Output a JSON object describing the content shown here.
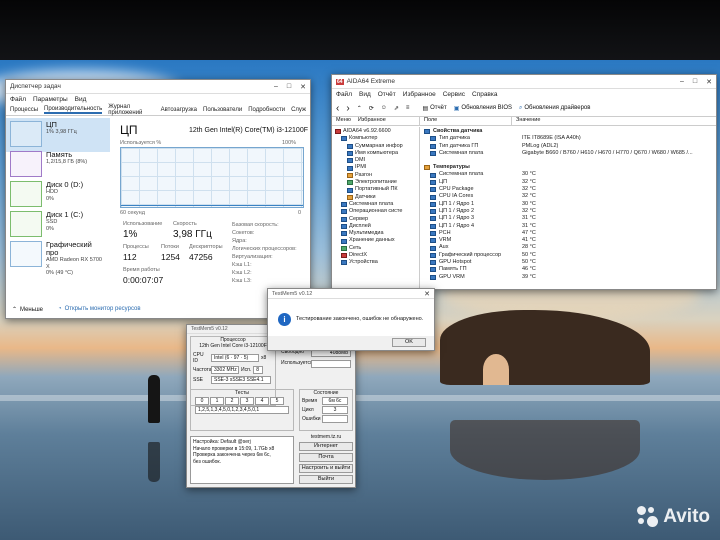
{
  "colors": {
    "accent": "#2b6cb0",
    "cpu_graph": "#76a6cf",
    "error_red": "#c93b3b"
  },
  "taskmgr": {
    "title": "Диспетчер задач",
    "menu": [
      "Файл",
      "Параметры",
      "Вид"
    ],
    "tabs": [
      "Процессы",
      "Производительность",
      "Журнал приложений",
      "Автозагрузка",
      "Пользователи",
      "Подробности",
      "Служ"
    ],
    "sidebar": [
      {
        "name": "ЦП",
        "sub": "1% 3,98 ГГц",
        "sub2": ""
      },
      {
        "name": "Память",
        "sub": "1,2/15,8 ГБ (8%)",
        "sub2": ""
      },
      {
        "name": "Диск 0 (D:)",
        "sub": "HDD",
        "sub2": "0%"
      },
      {
        "name": "Диск 1 (C:)",
        "sub": "SSD",
        "sub2": "0%"
      },
      {
        "name": "Графический про",
        "sub": "AMD Radeon RX 5700 X",
        "sub2": "0% (49 °C)"
      }
    ],
    "heading": "ЦП",
    "cpu_model": "12th Gen Intel(R) Core(TM) i3-12100F",
    "graph_caption": "Используется %",
    "graph_max": "100%",
    "graph_span": "60 секунд",
    "graph_min": "0",
    "stats": {
      "util_label": "Использование",
      "util_value": "1%",
      "speed_label": "Скорость",
      "speed_value": "3,98 ГГц",
      "proc_label": "Процессы",
      "proc_value": "112",
      "threads_label": "Потоки",
      "threads_value": "1254",
      "handles_label": "Дескрипторы",
      "handles_value": "47256",
      "uptime_label": "Время работы",
      "uptime_value": "0:00:07:07"
    },
    "spec_labels": [
      "Базовая скорость:",
      "Сокетов:",
      "Ядра:",
      "Логических процессоров:",
      "Виртуализация:",
      "Кэш L1:",
      "Кэш L2:",
      "Кэш L3:"
    ],
    "footer_less": "Меньше",
    "footer_link": "Открыть монитор ресурсов"
  },
  "aida": {
    "title": "AIDA64 Extreme",
    "menu": [
      "Файл",
      "Вид",
      "Отчёт",
      "Избранное",
      "Сервис",
      "Справка"
    ],
    "toolbar": {
      "report": "Отчёт",
      "bios": "Обновления BIOS",
      "drivers": "Обновления драйверов"
    },
    "tree_tabs": [
      "Меню",
      "Избранное"
    ],
    "tree": [
      {
        "t": "AIDA64 v6.92.6600",
        "i": "r",
        "d": 0
      },
      {
        "t": "Компьютер",
        "i": "b",
        "d": 1
      },
      {
        "t": "Суммарная инфор",
        "i": "b",
        "d": 2
      },
      {
        "t": "Имя компьютера",
        "i": "b",
        "d": 2
      },
      {
        "t": "DMI",
        "i": "b",
        "d": 2
      },
      {
        "t": "IPMI",
        "i": "b",
        "d": 2
      },
      {
        "t": "Разгон",
        "i": "o",
        "d": 2
      },
      {
        "t": "Электропитание",
        "i": "g",
        "d": 2
      },
      {
        "t": "Портативный ПК",
        "i": "b",
        "d": 2
      },
      {
        "t": "Датчики",
        "i": "o",
        "d": 2
      },
      {
        "t": "Системная плата",
        "i": "b",
        "d": 1
      },
      {
        "t": "Операционная систе",
        "i": "b",
        "d": 1
      },
      {
        "t": "Сервер",
        "i": "b",
        "d": 1
      },
      {
        "t": "Дисплей",
        "i": "b",
        "d": 1
      },
      {
        "t": "Мультимедиа",
        "i": "b",
        "d": 1
      },
      {
        "t": "Хранение данных",
        "i": "b",
        "d": 1
      },
      {
        "t": "Сеть",
        "i": "g",
        "d": 1
      },
      {
        "t": "DirectX",
        "i": "r",
        "d": 1
      },
      {
        "t": "Устройства",
        "i": "b",
        "d": 1
      }
    ],
    "columns": [
      "Поле",
      "Значение"
    ],
    "sensor_props": {
      "heading": "Свойства датчика",
      "rows": [
        [
          "Тип датчика",
          "ITE IT8689E (ISA A40h)"
        ],
        [
          "Тип датчика ГП",
          "PMLog (ADL2)"
        ],
        [
          "Системная плата",
          "Gigabyte B660 / B760 / H610 / H670 / H770 / Q670 / W680 / W685 /..."
        ]
      ]
    },
    "temps": {
      "heading": "Температуры",
      "rows": [
        [
          "Системная плата",
          "30 °C"
        ],
        [
          "ЦП",
          "32 °C"
        ],
        [
          "CPU Package",
          "32 °C"
        ],
        [
          "CPU IA Cores",
          "32 °C"
        ],
        [
          "ЦП 1 / Ядро 1",
          "30 °C"
        ],
        [
          "ЦП 1 / Ядро 2",
          "32 °C"
        ],
        [
          "ЦП 1 / Ядро 3",
          "31 °C"
        ],
        [
          "ЦП 1 / Ядро 4",
          "31 °C"
        ],
        [
          "PCH",
          "47 °C"
        ],
        [
          "VRM",
          "41 °C"
        ],
        [
          "Aux",
          "28 °C"
        ],
        [
          "Графический процессор",
          "50 °C"
        ],
        [
          "GPU Hotspot",
          "50 °C"
        ],
        [
          "Память ГП",
          "46 °C"
        ],
        [
          "GPU VRM",
          "39 °C"
        ]
      ]
    }
  },
  "dialog": {
    "title": "TestMem5 v0.12",
    "message": "Тестирование закончено, ошибок не обнаружено.",
    "ok": "OK"
  },
  "testmem": {
    "title": "TestMem5 v0.12",
    "group_cpu": "Процессор",
    "cpu_name": "12th Gen Intel Core i3-12100F",
    "cpu_id_label": "CPU ID",
    "cpu_id": "Intel (6 · 97 · 5)",
    "cpu_id_extra": "x8",
    "freq_label": "Частота",
    "freq_value": "3302 MHz",
    "threads_label": "Исп.",
    "threads_value": "8",
    "sse_label": "SSE",
    "sse_value": "SSE-3 sSSE3 SSE4.1",
    "mem_labels": [
      "Свободно",
      "Используется"
    ],
    "mem_value": "4088Mb",
    "tests_title": "Тесты",
    "tests_header": [
      "0",
      "1",
      "2",
      "3",
      "4",
      "5"
    ],
    "tests_sequence": "1,2,5,1,3,4,5,0,1,2,3,4,5,0,1",
    "state_title": "Состояние",
    "state_labels": [
      "Время",
      "Цикл",
      "Ошибки"
    ],
    "state_values": [
      "6м 6с",
      "3",
      ""
    ],
    "log": [
      "Настройка: Default @serj",
      "Начало проверки в 15:09, 1.7Gb x8",
      "Проверка закончена через 6м 6с,",
      "без ошибок."
    ],
    "site": "testmem.tz.ru",
    "buttons": [
      "Интернет",
      "Почта",
      "Настроить и выйти",
      "Выйти"
    ]
  },
  "watermark": "Avito"
}
